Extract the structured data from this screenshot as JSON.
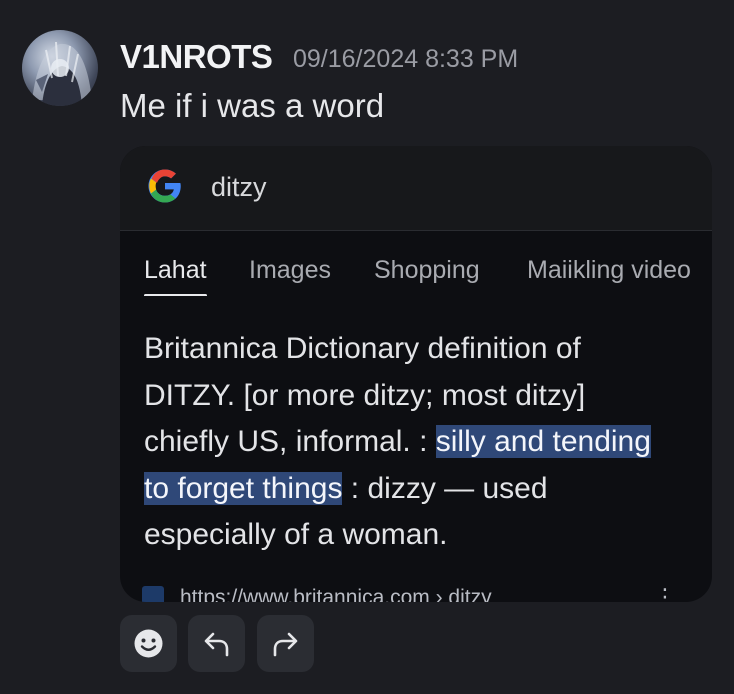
{
  "author": {
    "name": "V1NROTS",
    "avatar_icon": "anime-character-avatar"
  },
  "timestamp": "09/16/2024 8:33 PM",
  "message": "Me if i was a word",
  "embed": {
    "search_query": "ditzy",
    "logo_icon": "google-g-icon",
    "tabs": [
      {
        "label": "Lahat",
        "active": true
      },
      {
        "label": "Images",
        "active": false
      },
      {
        "label": "Shopping",
        "active": false
      },
      {
        "label": "Maiikling video",
        "active": false
      }
    ],
    "definition": {
      "before": "Britannica Dictionary definition of DITZY. [or more ditzy; most ditzy] chiefly US, informal. : ",
      "highlight": "silly and tending to forget things",
      "after": " : dizzy — used especially of a woman."
    },
    "source_url": "https://www.britannica.com › ditzy",
    "source_icon": "britannica-icon",
    "more_icon": "vertical-dots-icon"
  },
  "actions": [
    {
      "icon": "emoji-smile-icon"
    },
    {
      "icon": "reply-icon"
    },
    {
      "icon": "forward-icon"
    }
  ],
  "colors": {
    "background": "#1c1d22",
    "embed_background": "#0d0e12",
    "highlight": "#2f4878",
    "button": "#2b2d33"
  }
}
